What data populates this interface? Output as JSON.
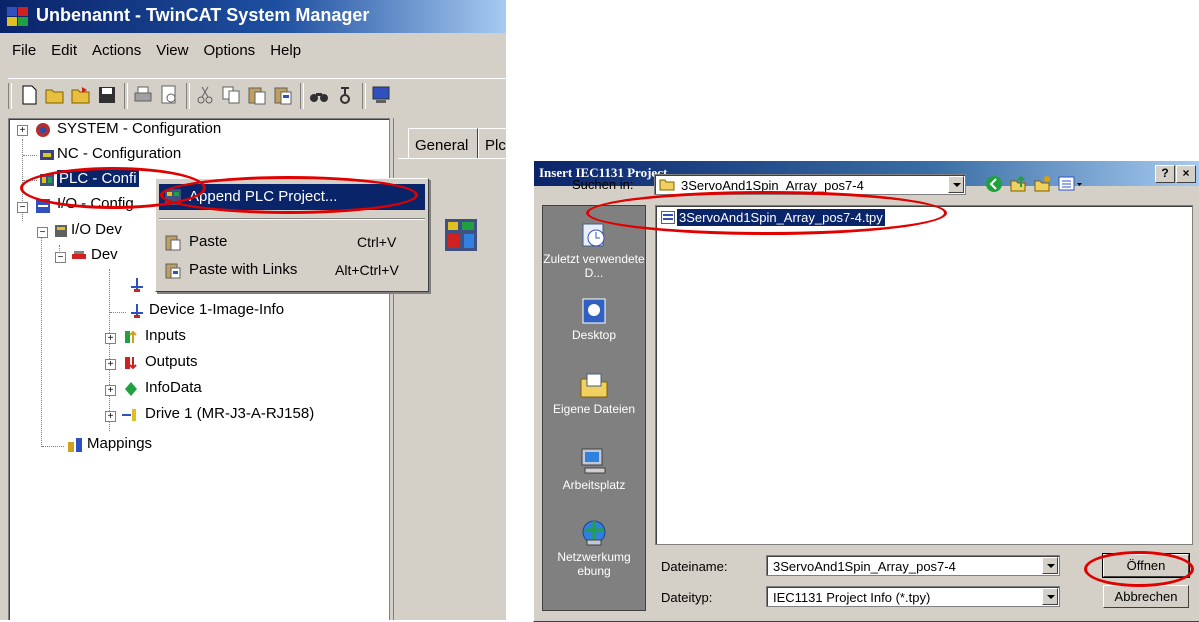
{
  "twincat": {
    "title": "Unbenannt - TwinCAT System Manager",
    "menu": [
      "File",
      "Edit",
      "Actions",
      "View",
      "Options",
      "Help"
    ],
    "tree": {
      "system": "SYSTEM - Configuration",
      "nc": "NC - Configuration",
      "plc": "PLC - Confi",
      "io": "I/O - Config",
      "io_devices": "I/O Dev",
      "device1": "Dev",
      "image_info": "Device 1-Image-Info",
      "inputs": "Inputs",
      "outputs": "Outputs",
      "infodata": "InfoData",
      "drive1": "Drive 1 (MR-J3-A-RJ158)",
      "mappings": "Mappings"
    },
    "tabs": [
      "General",
      "Plc"
    ],
    "context_menu": [
      {
        "label": "Append PLC Project...",
        "shortcut": ""
      },
      {
        "label": "Paste",
        "shortcut": "Ctrl+V"
      },
      {
        "label": "Paste with Links",
        "shortcut": "Alt+Ctrl+V"
      }
    ]
  },
  "dialog": {
    "title": "Insert IEC1131 Project",
    "help_btn": "?",
    "close_btn": "×",
    "look_in_label": "Suchen in:",
    "look_in_value": "3ServoAnd1Spin_Array_pos7-4",
    "places": [
      {
        "label": "Zuletzt verwendete D...",
        "icon": "recent-documents-icon"
      },
      {
        "label": "Desktop",
        "icon": "desktop-icon"
      },
      {
        "label": "Eigene Dateien",
        "icon": "my-documents-icon"
      },
      {
        "label": "Arbeitsplatz",
        "icon": "my-computer-icon"
      },
      {
        "label": "Netzwerkumgebung",
        "icon": "network-icon"
      }
    ],
    "files": [
      "3ServoAnd1Spin_Array_pos7-4.tpy"
    ],
    "filename_label": "Dateiname:",
    "filename_value": "3ServoAnd1Spin_Array_pos7-4",
    "filetype_label": "Dateityp:",
    "filetype_value": "IEC1131 Project Info (*.tpy)",
    "open_button": "Öffnen",
    "cancel_button": "Abbrechen"
  },
  "colors": {
    "titlebar": "#0a246a",
    "highlight_oval": "#e00000",
    "window_bg": "#d4d0c8"
  }
}
